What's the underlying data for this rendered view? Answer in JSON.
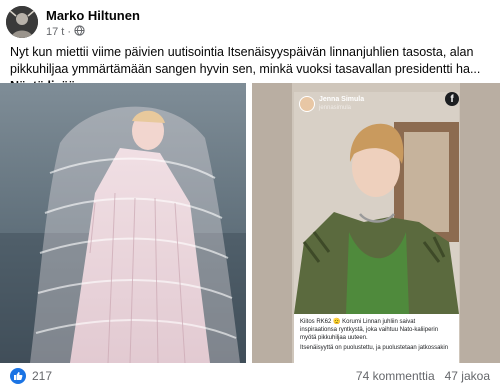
{
  "post": {
    "author": "Marko Hiltunen",
    "time": "17 t",
    "separator": "·",
    "text": "Nyt kun miettii viime päivien uutisointia Itsenäisyyspäivän linnanjuhlien tasosta, alan pikkuhiljaa ymmärtämään sangen hyvin sen, minkä vuoksi tasavallan presidentti ha...",
    "see_more": "Näytä lisää"
  },
  "screenshot_story": {
    "name": "Jenna Simula",
    "handle": "jennasimula",
    "caption_line1": "Kiitos RK62 🫡 Korumi Linnan juhliin saivat inspiraationsa ryntkystä, joka vaihtuu Nato-kaliiperin myötä pikkuhiljaa uuteen.",
    "caption_line2": "Itsenäisyyttä on puolustettu, ja puolustetaan jatkossakin"
  },
  "footer": {
    "reactions_count": "217",
    "comments": "74 kommenttia",
    "shares": "47 jakoa"
  },
  "colors": {
    "accent": "#1b74e4",
    "secondary_text": "#65676b"
  },
  "icons": {
    "privacy": "globe-icon",
    "reaction": "like-icon",
    "brand": "facebook-icon"
  }
}
